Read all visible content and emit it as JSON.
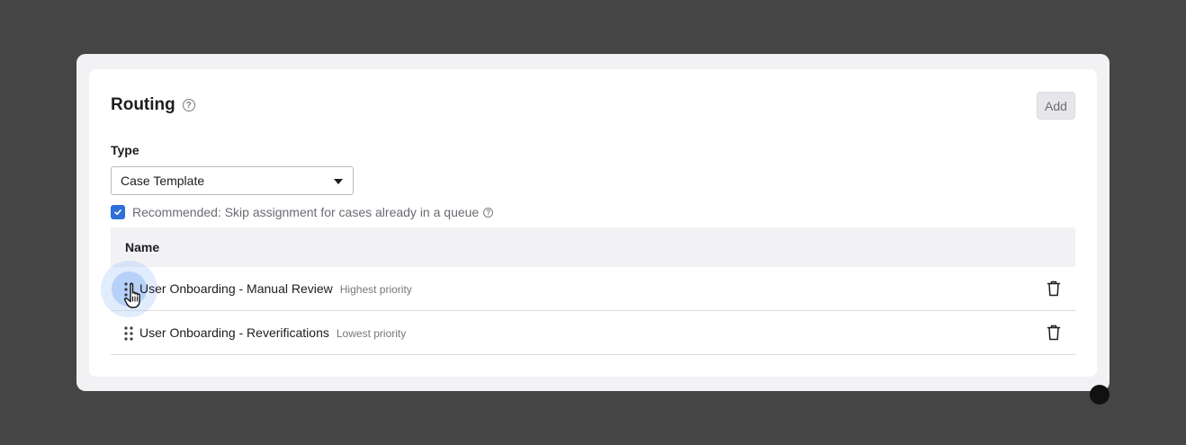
{
  "panel": {
    "title": "Routing",
    "help_icon": "question-circle-icon",
    "add_label": "Add"
  },
  "type_field": {
    "label": "Type",
    "selected": "Case Template"
  },
  "skip_option": {
    "checked": true,
    "label": "Recommended: Skip assignment for cases already in a queue"
  },
  "table": {
    "header": "Name",
    "rows": [
      {
        "name": "User Onboarding - Manual Review",
        "priority": "Highest priority"
      },
      {
        "name": "User Onboarding - Reverifications",
        "priority": "Lowest priority"
      }
    ]
  },
  "icons": {
    "drag": "drag-handle-icon",
    "delete": "trash-icon",
    "cursor": "hand-pointer-icon"
  },
  "colors": {
    "accent": "#2f6fdb",
    "backdrop": "#454545"
  }
}
